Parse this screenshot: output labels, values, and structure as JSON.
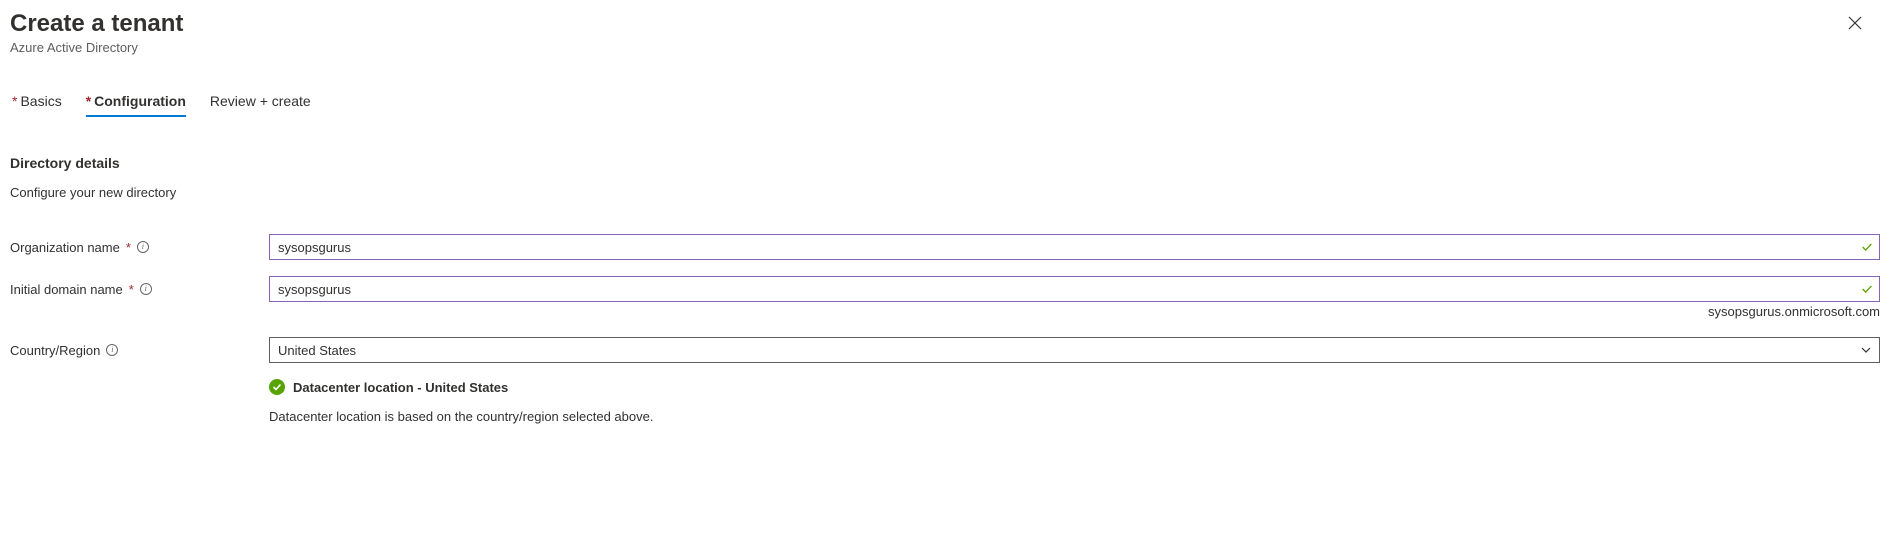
{
  "header": {
    "title": "Create a tenant",
    "subtitle": "Azure Active Directory"
  },
  "tabs": {
    "basics": "Basics",
    "configuration": "Configuration",
    "review": "Review + create"
  },
  "section": {
    "title": "Directory details",
    "description": "Configure your new directory"
  },
  "form": {
    "org_name": {
      "label": "Organization name",
      "value": "sysopsgurus"
    },
    "domain_name": {
      "label": "Initial domain name",
      "value": "sysopsgurus",
      "helper": "sysopsgurus.onmicrosoft.com"
    },
    "country": {
      "label": "Country/Region",
      "value": "United States"
    }
  },
  "datacenter": {
    "status": "Datacenter location - United States",
    "note": "Datacenter location is based on the country/region selected above."
  }
}
